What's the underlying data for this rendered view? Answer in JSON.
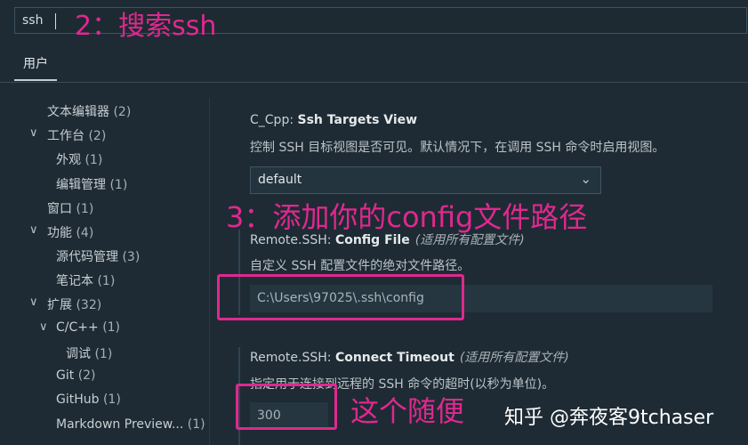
{
  "search": {
    "value": "ssh"
  },
  "annotations": {
    "step2": "2：搜索ssh",
    "step3": "3：添加你的config文件路径",
    "step4": "这个随便"
  },
  "tabs": [
    {
      "label": "用户"
    }
  ],
  "tree": [
    {
      "label": "文本编辑器",
      "count": "(2)"
    },
    {
      "label": "工作台",
      "count": "(2)"
    },
    {
      "label": "外观",
      "count": "(1)"
    },
    {
      "label": "编辑管理",
      "count": "(1)"
    },
    {
      "label": "窗口",
      "count": "(1)"
    },
    {
      "label": "功能",
      "count": "(4)"
    },
    {
      "label": "源代码管理",
      "count": "(3)"
    },
    {
      "label": "笔记本",
      "count": "(1)"
    },
    {
      "label": "扩展",
      "count": "(32)"
    },
    {
      "label": "C/C++",
      "count": "(1)"
    },
    {
      "label": "调试",
      "count": "(1)"
    },
    {
      "label": "Git",
      "count": "(2)"
    },
    {
      "label": "GitHub",
      "count": "(1)"
    },
    {
      "label": "Markdown Preview...",
      "count": "(1)"
    }
  ],
  "settings": {
    "ssh_targets": {
      "prefix": "C_Cpp: ",
      "name": "Ssh Targets View",
      "description": "控制 SSH 目标视图是否可见。默认情况下，在调用 SSH 命令时启用视图。",
      "value": "default"
    },
    "config_file": {
      "prefix": "Remote.SSH: ",
      "name": "Config File",
      "scope": "(适用所有配置文件)",
      "description": "自定义 SSH 配置文件的绝对文件路径。",
      "value": "C:\\Users\\97025\\.ssh\\config"
    },
    "connect_timeout": {
      "prefix": "Remote.SSH: ",
      "name": "Connect Timeout",
      "scope": "(适用所有配置文件)",
      "description": "指定用于连接到远程的 SSH 命令的超时(以秒为单位)。",
      "value": "300"
    }
  },
  "watermark": "知乎 @奔夜客9tchaser",
  "colors": {
    "accent": "#e0288f",
    "background": "#1e2b34"
  }
}
